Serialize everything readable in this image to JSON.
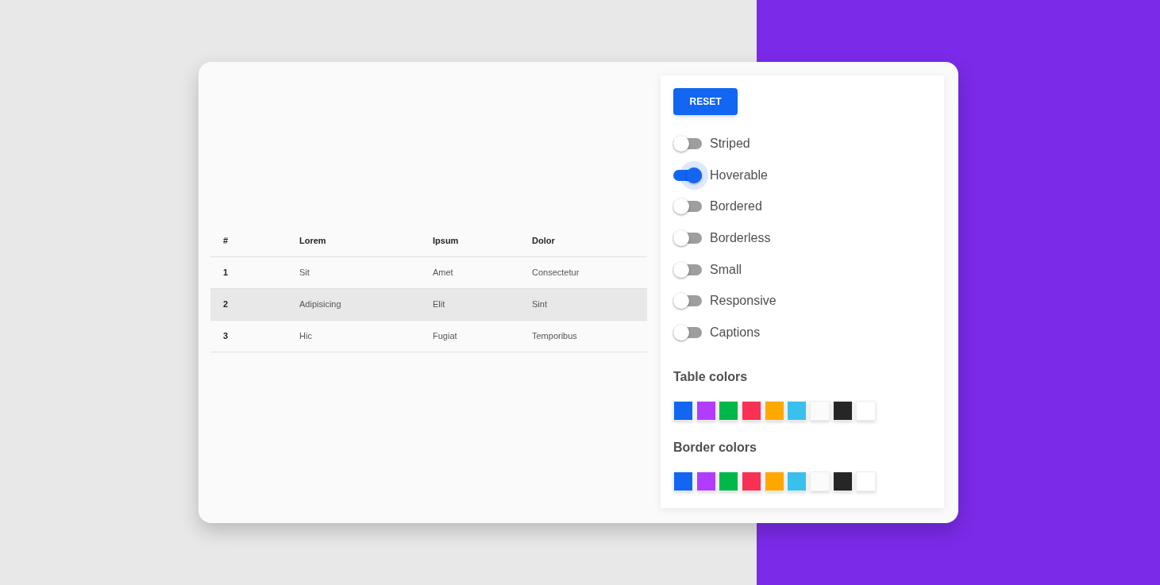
{
  "table": {
    "columns": [
      "#",
      "Lorem",
      "Ipsum",
      "Dolor"
    ],
    "rows": [
      {
        "cells": [
          "1",
          "Sit",
          "Amet",
          "Consectetur"
        ],
        "hovered": false
      },
      {
        "cells": [
          "2",
          "Adipisicing",
          "Elit",
          "Sint"
        ],
        "hovered": true
      },
      {
        "cells": [
          "3",
          "Hic",
          "Fugiat",
          "Temporibus"
        ],
        "hovered": false
      }
    ]
  },
  "panel": {
    "reset_button": "RESET",
    "toggles": [
      {
        "label": "Striped",
        "on": false
      },
      {
        "label": "Hoverable",
        "on": true
      },
      {
        "label": "Bordered",
        "on": false
      },
      {
        "label": "Borderless",
        "on": false
      },
      {
        "label": "Small",
        "on": false
      },
      {
        "label": "Responsive",
        "on": false
      },
      {
        "label": "Captions",
        "on": false
      }
    ],
    "table_colors": {
      "title": "Table colors",
      "swatches": [
        {
          "color": "#1266f1"
        },
        {
          "color": "#b23cfd"
        },
        {
          "color": "#00b74a"
        },
        {
          "color": "#f93154"
        },
        {
          "color": "#ffa900"
        },
        {
          "color": "#39c0ed"
        },
        {
          "color": "#fbfbfb"
        },
        {
          "color": "#262626"
        },
        {
          "color": "#ffffff"
        }
      ]
    },
    "border_colors": {
      "title": "Border colors",
      "swatches": [
        {
          "color": "#1266f1"
        },
        {
          "color": "#b23cfd"
        },
        {
          "color": "#00b74a"
        },
        {
          "color": "#f93154"
        },
        {
          "color": "#ffa900"
        },
        {
          "color": "#39c0ed"
        },
        {
          "color": "#fbfbfb"
        },
        {
          "color": "#262626"
        },
        {
          "color": "#ffffff"
        }
      ]
    }
  }
}
